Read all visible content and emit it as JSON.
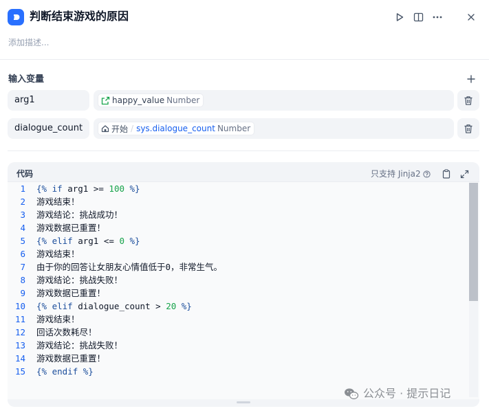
{
  "header": {
    "title": "判断结束游戏的原因",
    "icons": {
      "app": "code-node-icon",
      "run": "play-icon",
      "panel": "split-panel-icon",
      "more": "more-icon",
      "close": "close-icon"
    }
  },
  "description_placeholder": "添加描述...",
  "input_section": {
    "title": "输入变量",
    "add_icon": "plus-icon",
    "variables": [
      {
        "name": "arg1",
        "source_icon": "variable-link-icon",
        "source_node": "",
        "var": "happy_value",
        "type": "Number"
      },
      {
        "name": "dialogue_count",
        "source_icon": "home-icon",
        "source_node": "开始",
        "var": "sys.dialogue_count",
        "type": "Number"
      }
    ]
  },
  "code": {
    "label": "代码",
    "note": "只支持 Jinja2",
    "lines": [
      {
        "n": "1",
        "text": "{% if arg1 >= 100 %}"
      },
      {
        "n": "2",
        "text": "游戏结束！"
      },
      {
        "n": "3",
        "text": "游戏结论：挑战成功！"
      },
      {
        "n": "4",
        "text": "游戏数据已重置！"
      },
      {
        "n": "5",
        "text": "{% elif arg1 <= 0 %}"
      },
      {
        "n": "6",
        "text": "游戏结束！"
      },
      {
        "n": "7",
        "text": "由于你的回答让女朋友心情值低于0，非常生气。"
      },
      {
        "n": "8",
        "text": "游戏结论：挑战失败！"
      },
      {
        "n": "9",
        "text": "游戏数据已重置！"
      },
      {
        "n": "10",
        "text": "{% elif dialogue_count > 20 %}"
      },
      {
        "n": "11",
        "text": "游戏结束！"
      },
      {
        "n": "12",
        "text": "回话次数耗尽！"
      },
      {
        "n": "13",
        "text": "游戏结论：挑战失败！"
      },
      {
        "n": "14",
        "text": "游戏数据已重置！"
      },
      {
        "n": "15",
        "text": "{% endif %}"
      }
    ]
  },
  "watermark": "公众号 · 提示日记",
  "colors": {
    "accent": "#2970ff",
    "keyword": "#1c4e9c",
    "number": "#16a34a",
    "line_number": "#155eef"
  }
}
